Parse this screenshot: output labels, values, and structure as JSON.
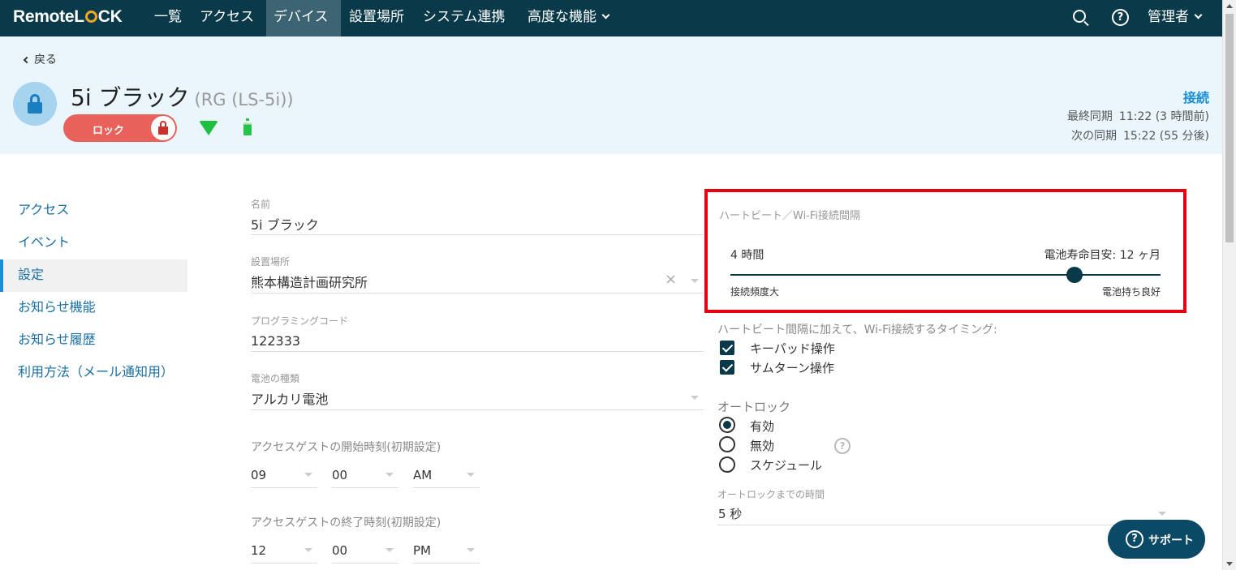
{
  "nav": {
    "logo_left": "Remote",
    "logo_right": "CK",
    "items": [
      "一覧",
      "アクセス",
      "デバイス",
      "設置場所",
      "システム連携",
      "高度な機能"
    ],
    "help_glyph": "?",
    "admin": "管理者",
    "icons": [
      "search-icon",
      "help-icon",
      "chevron-down-icon"
    ]
  },
  "header": {
    "back": "戻る",
    "device_name": "5i ブラック",
    "device_model": "(RG (LS-5i))",
    "lock_label": "ロック",
    "status": "接続",
    "last_sync_label": "最終同期",
    "last_sync_value": "11:22 (3 時間前)",
    "next_sync_label": "次の同期",
    "next_sync_value": "15:22 (55 分後)",
    "battery_level": 0.75,
    "colors": {
      "lock_pill": "#e8615a",
      "wifi": "#1fbf3f",
      "battery": "#27c24c",
      "status": "#1a8fd6"
    }
  },
  "sidebar": {
    "items": [
      "アクセス",
      "イベント",
      "設定",
      "お知らせ機能",
      "お知らせ履歴",
      "利用方法（メール通知用）"
    ],
    "active_index": 2
  },
  "form": {
    "name_label": "名前",
    "name_value": "5i ブラック",
    "location_label": "設置場所",
    "location_value": "熊本構造計画研究所",
    "location_clear": "×",
    "prog_label": "プログラミングコード",
    "prog_value": "122333",
    "battery_label": "電池の種類",
    "battery_value": "アルカリ電池",
    "start_label": "アクセスゲストの開始時刻(初期設定)",
    "start_hour": "09",
    "start_min": "00",
    "start_ampm": "AM",
    "end_label": "アクセスゲストの終了時刻(初期設定)",
    "end_hour": "12",
    "end_min": "00",
    "end_ampm": "PM"
  },
  "heartbeat": {
    "title": "ハートビート／Wi-Fi接続間隔",
    "interval_value": "4 時間",
    "battery_estimate": "電池寿命目安: 12 ヶ月",
    "min_label": "接続頻度大",
    "max_label": "電池持ち良好",
    "slider_position": 0.8
  },
  "timing": {
    "label": "ハートビート間隔に加えて、Wi-Fi接続するタイミング:",
    "keypad": "キーパッド操作",
    "thumbturn": "サムターン操作"
  },
  "autolock": {
    "label": "オートロック",
    "enabled": "有効",
    "disabled": "無効",
    "schedule": "スケジュール",
    "help_glyph": "?",
    "delay_label": "オートロックまでの時間",
    "delay_value": "5 秒"
  },
  "support": {
    "label": "サポート",
    "glyph": "?"
  }
}
